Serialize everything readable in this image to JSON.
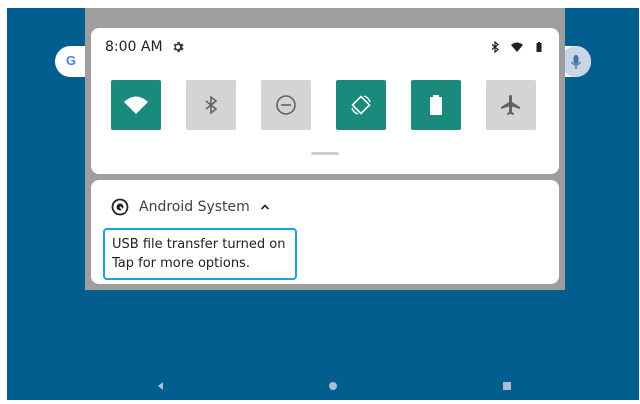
{
  "home": {
    "search_logo_letter": "G",
    "icons": {
      "search_logo": "google-logo",
      "mic": "microphone-icon"
    }
  },
  "status_bar": {
    "time": "8:00 AM",
    "icons": [
      "gear-icon",
      "bluetooth-icon",
      "wifi-icon",
      "battery-icon"
    ]
  },
  "quick_settings": {
    "tiles": [
      {
        "name": "wifi",
        "icon": "wifi-icon",
        "state": "on"
      },
      {
        "name": "bluetooth",
        "icon": "bluetooth-icon",
        "state": "off"
      },
      {
        "name": "do-not-disturb",
        "icon": "do-not-disturb-icon",
        "state": "off"
      },
      {
        "name": "auto-rotate",
        "icon": "auto-rotate-icon",
        "state": "on"
      },
      {
        "name": "battery-saver",
        "icon": "battery-icon",
        "state": "on"
      },
      {
        "name": "airplane-mode",
        "icon": "airplane-icon",
        "state": "off"
      }
    ]
  },
  "notification": {
    "app_name": "Android System",
    "title": "USB file transfer turned on",
    "text": "Tap for more options."
  },
  "navigation": {
    "buttons": [
      "back-icon",
      "home-icon",
      "recents-icon"
    ]
  },
  "colors": {
    "wallpaper": "#015e8f",
    "tile_on": "#1a8a7c",
    "tile_off": "#d4d4d4",
    "scrim": "#9e9e9e",
    "focus_outline": "#1ba4dc"
  }
}
